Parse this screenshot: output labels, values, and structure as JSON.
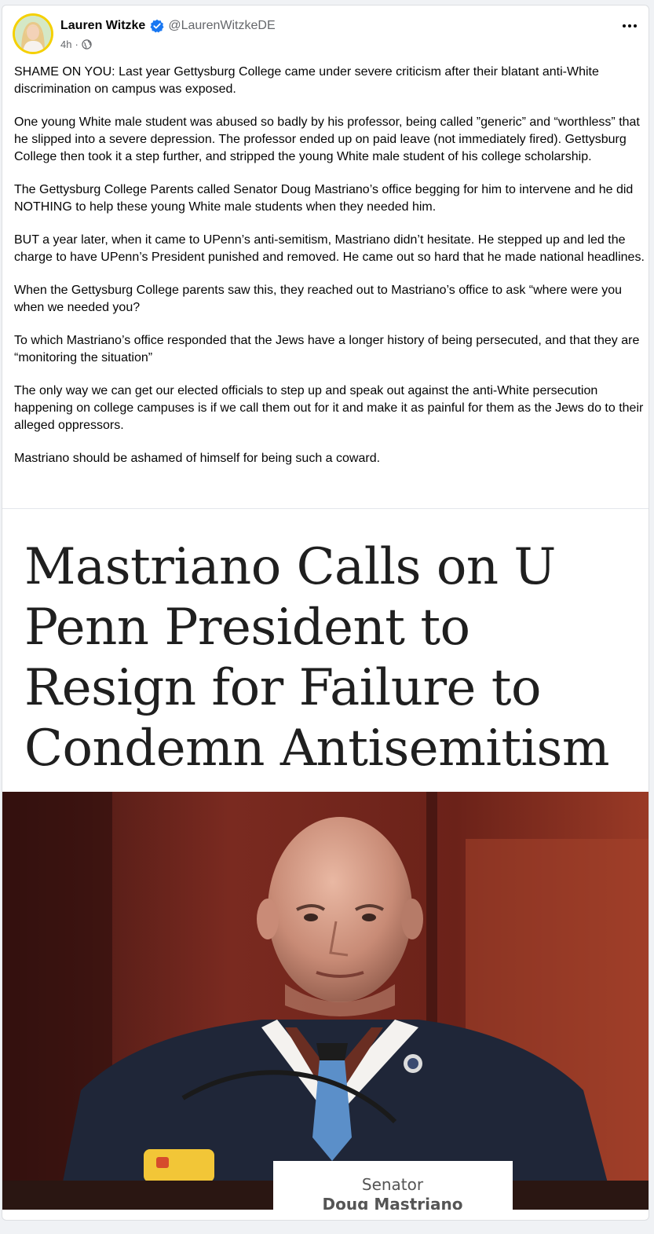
{
  "author": {
    "name": "Lauren Witzke",
    "handle": "@LaurenWitzkeDE",
    "verified_icon": "verified-badge-icon"
  },
  "meta": {
    "time": "4h",
    "separator": "·",
    "audience_icon": "globe-icon"
  },
  "menu": {
    "more_icon": "more-options-icon"
  },
  "post": {
    "paragraphs": [
      "SHAME ON YOU: Last year Gettysburg College came under severe criticism after their blatant anti-White discrimination on campus was exposed.",
      "One young White male student was abused so badly by his professor, being called ”generic” and “worthless” that he slipped into a severe depression. The professor ended up on paid leave (not immediately fired). Gettysburg College then took it a step further, and stripped the young White male student of his college scholarship.",
      "The Gettysburg College Parents called Senator Doug Mastriano’s office begging for him to intervene and he did NOTHING to help these young White male students when they needed him.",
      "BUT a year later, when it came to UPenn’s anti-semitism, Mastriano didn’t hesitate. He stepped up and led the charge to have UPenn’s President punished and removed. He came out so hard that he made national headlines.",
      "When the Gettysburg College parents saw this, they reached out to Mastriano’s office to ask “where were you when we needed you?",
      "To which Mastriano’s office responded that the Jews have a longer history of being persecuted, and that they are “monitoring the situation”",
      "The only way we can get our elected officials to step up and speak out against the anti-White persecution happening on college campuses is if we call them out for it and make it as painful for them as the Jews do to their alleged oppressors.",
      "Mastriano should be ashamed of himself for being such a coward."
    ]
  },
  "media": {
    "headline": "Mastriano Calls on U Penn President to Resign for Failure to Condemn Antisemitism",
    "nameplate_line1": "Senator",
    "nameplate_line2": "Doug Mastriano"
  }
}
